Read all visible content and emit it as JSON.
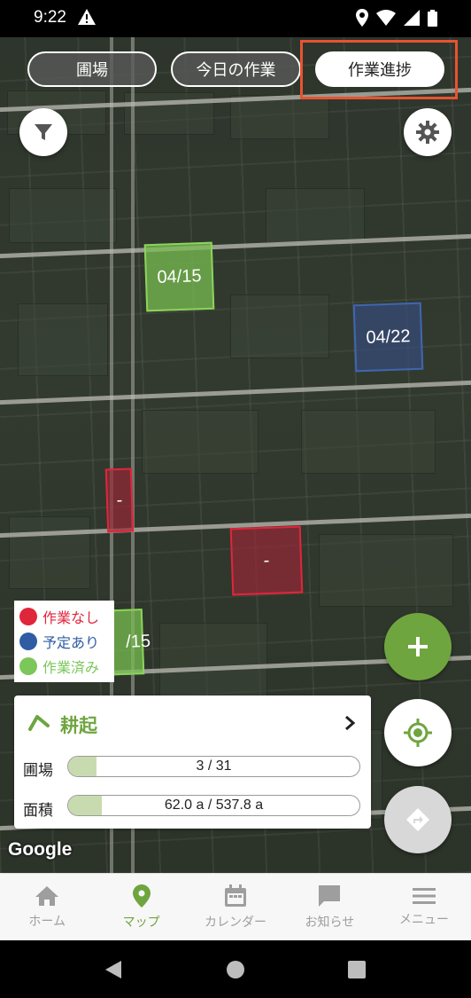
{
  "status_bar": {
    "time": "9:22"
  },
  "tabs": [
    {
      "label": "圃場",
      "active": false
    },
    {
      "label": "今日の作業",
      "active": false
    },
    {
      "label": "作業進捗",
      "active": true
    }
  ],
  "fields": [
    {
      "label": "04/15",
      "status": "done"
    },
    {
      "label": "04/22",
      "status": "planned"
    },
    {
      "label": "-",
      "status": "none"
    },
    {
      "label": "-",
      "status": "none"
    },
    {
      "label": "/15",
      "status": "done"
    }
  ],
  "legend": [
    {
      "label": "作業なし",
      "color": "#e0263a"
    },
    {
      "label": "予定あり",
      "color": "#2f5ca3"
    },
    {
      "label": "作業済み",
      "color": "#7bc75a"
    }
  ],
  "summary": {
    "task": "耕起",
    "rows": [
      {
        "label": "圃場",
        "text": "3  /  31",
        "progress": 0.097
      },
      {
        "label": "面積",
        "text": "62.0 a  /  537.8 a",
        "progress": 0.115
      }
    ]
  },
  "map_attribution": "Google",
  "bottom_nav": [
    {
      "label": "ホーム",
      "icon": "home-icon",
      "active": false
    },
    {
      "label": "マップ",
      "icon": "map-pin-icon",
      "active": true
    },
    {
      "label": "カレンダー",
      "icon": "calendar-icon",
      "active": false
    },
    {
      "label": "お知らせ",
      "icon": "chat-icon",
      "active": false
    },
    {
      "label": "メニュー",
      "icon": "menu-icon",
      "active": false
    }
  ],
  "colors": {
    "accent": "#6fa53f",
    "highlight": "#e85330"
  }
}
